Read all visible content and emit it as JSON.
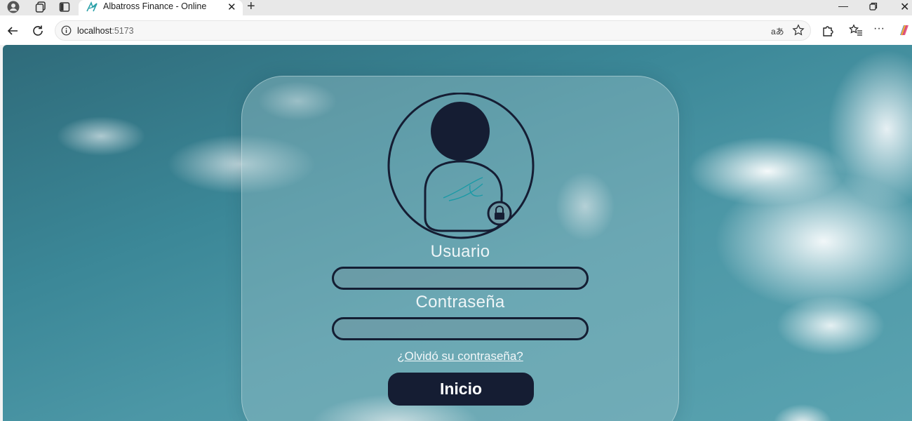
{
  "browser": {
    "tab_title": "Albatross Finance - Online",
    "url_host": "localhost",
    "url_port": ":5173",
    "icons": {
      "profile": "profile-icon",
      "workspaces": "workspaces-icon",
      "tab_actions": "tab-actions-icon",
      "favicon": "albatross-favicon-icon",
      "close": "close-icon",
      "new_tab": "plus-icon",
      "minimize": "minimize-icon",
      "restore": "restore-icon",
      "close_window": "close-window-icon",
      "back": "back-arrow-icon",
      "refresh": "refresh-icon",
      "info": "info-icon",
      "translate": "translate-icon",
      "favorite": "star-icon",
      "extensions": "extensions-icon",
      "favorites_list": "favorites-list-icon",
      "more": "more-icon",
      "copilot": "copilot-icon"
    }
  },
  "login": {
    "user_label": "Usuario",
    "user_value": "",
    "password_label": "Contraseña",
    "password_value": "",
    "forgot_link": "¿Olvidó su contraseña?",
    "submit_label": "Inicio"
  },
  "colors": {
    "button_bg": "#151d33",
    "field_border": "#141e33",
    "label_text": "#eef5f7",
    "sky": "#3b8797"
  }
}
